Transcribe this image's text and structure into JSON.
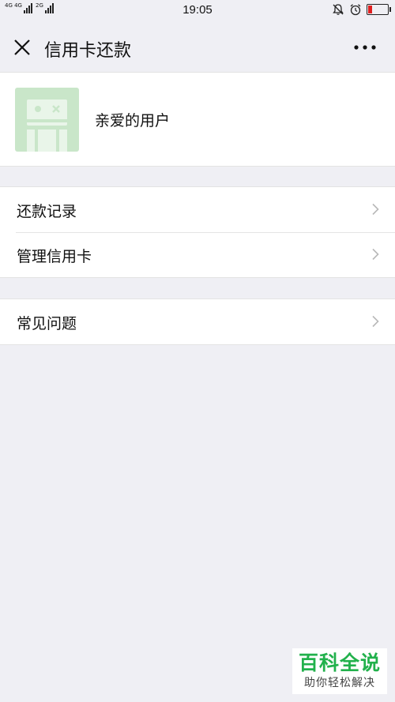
{
  "status_bar": {
    "signal_1_label": "4G 4G",
    "signal_2_label": "2G",
    "time": "19:05",
    "icons": [
      "bell-off-icon",
      "alarm-icon",
      "battery-icon"
    ],
    "battery_level": 0.2,
    "battery_color": "#e02020"
  },
  "nav": {
    "title": "信用卡还款",
    "close_icon": "close-icon",
    "more_icon": "more-icon"
  },
  "profile": {
    "name": "亲爱的用户",
    "avatar_color": "#c9e6c9"
  },
  "menu_group_1": {
    "items": [
      {
        "label": "还款记录",
        "icon": "chevron-right-icon"
      },
      {
        "label": "管理信用卡",
        "icon": "chevron-right-icon"
      }
    ]
  },
  "menu_group_2": {
    "items": [
      {
        "label": "常见问题",
        "icon": "chevron-right-icon"
      }
    ]
  },
  "watermark": {
    "main": "百科全说",
    "sub": "助你轻松解决",
    "color": "#22b14c"
  }
}
